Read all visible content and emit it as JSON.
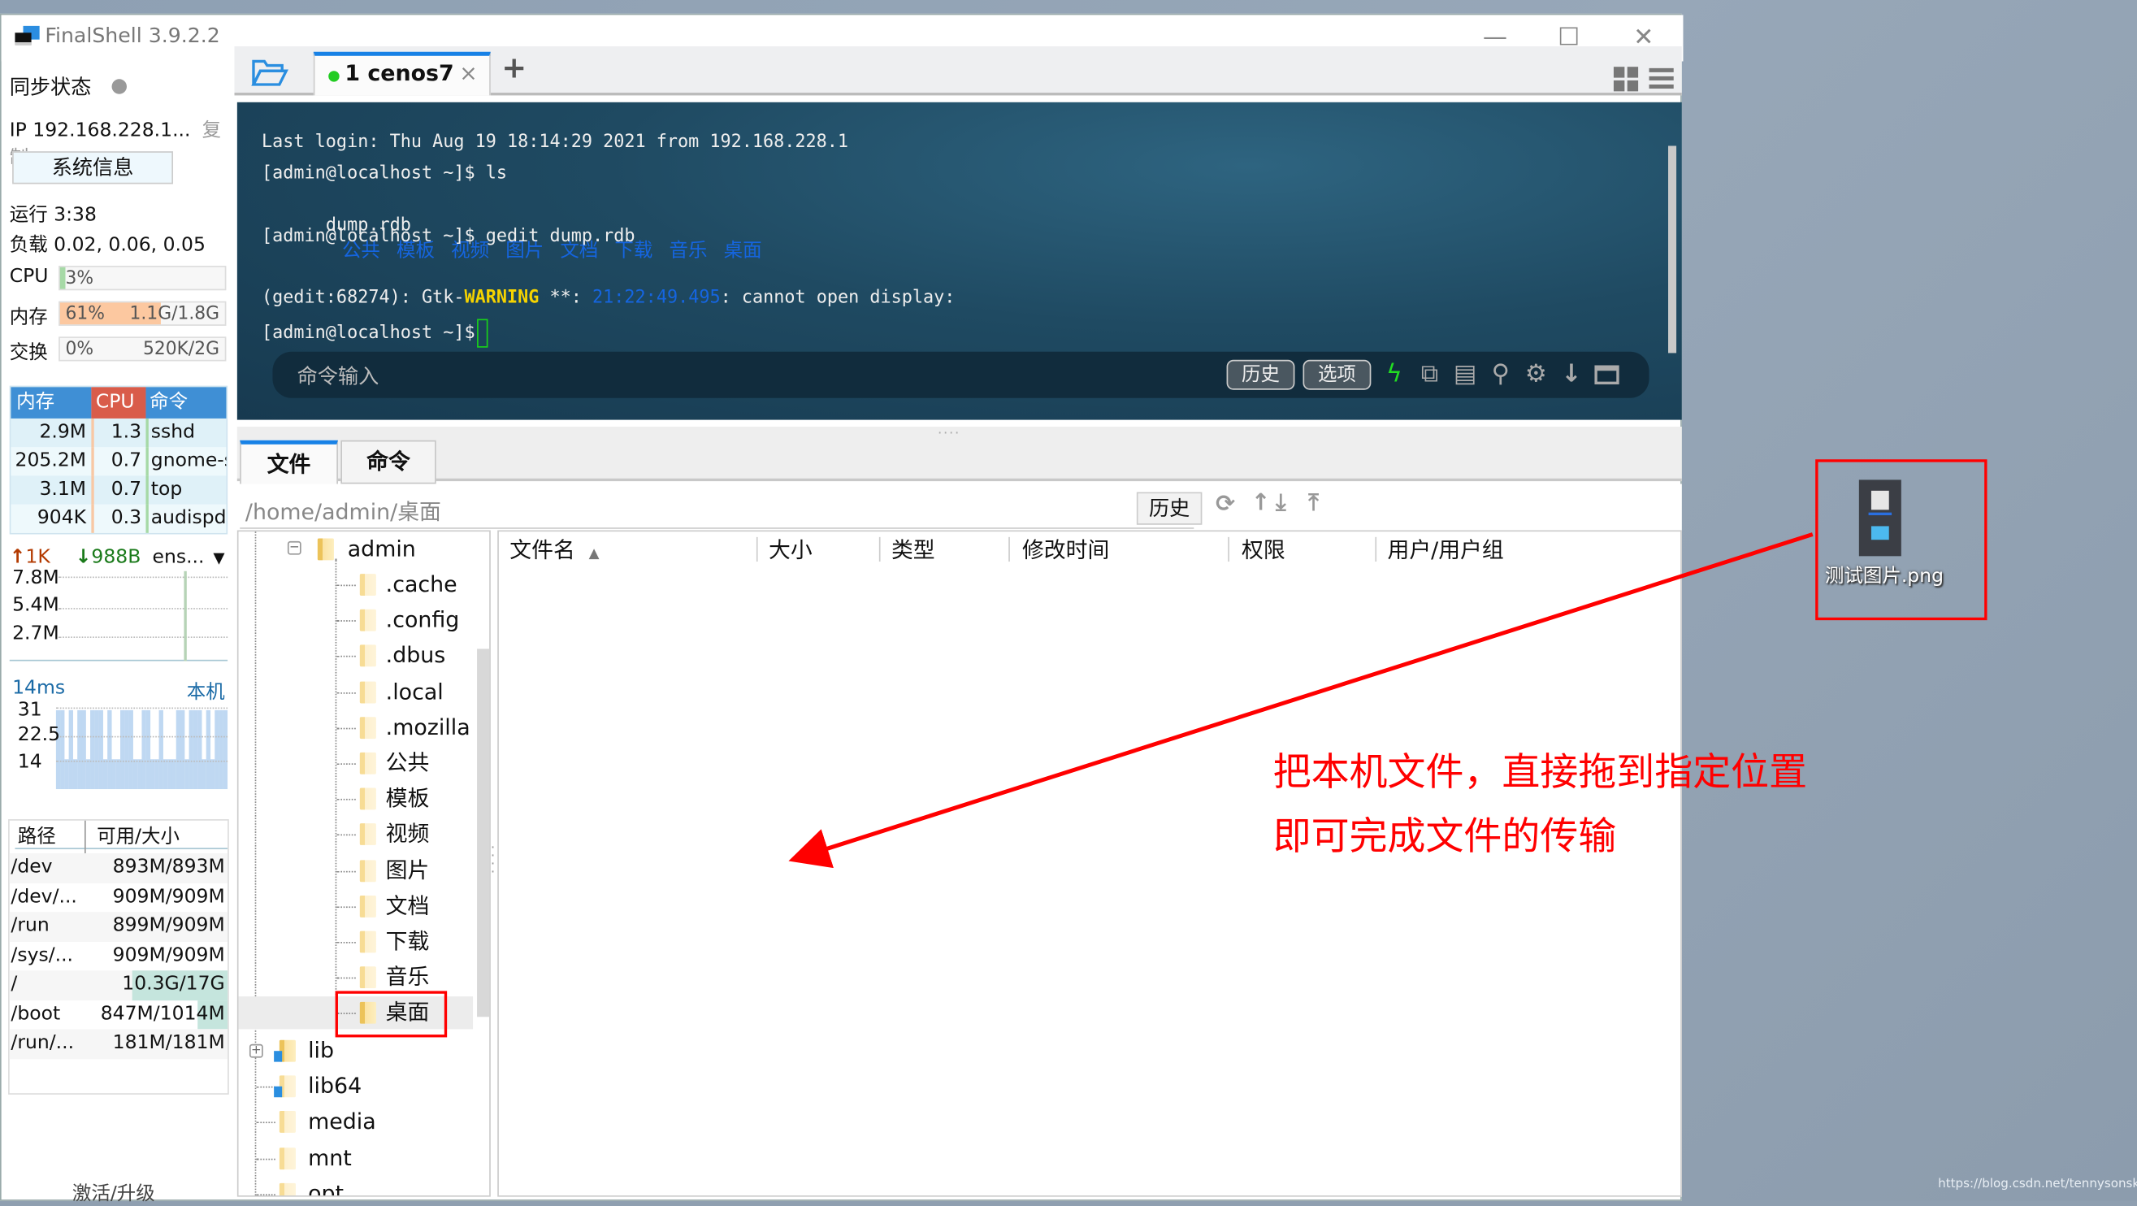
{
  "window": {
    "title": "FinalShell 3.9.2.2",
    "controls": {
      "minimize": "—",
      "maximize": "☐",
      "close": "✕"
    }
  },
  "sidebar": {
    "sync_label": "同步状态",
    "ip_label": "IP 192.168.228.1...",
    "copy_label": "复制",
    "sysinfo_button": "系统信息",
    "uptime": "运行 3:38",
    "load": "负载 0.02, 0.06, 0.05",
    "cpu": {
      "label": "CPU",
      "percent_text": "3%",
      "percent": 3
    },
    "memory": {
      "label": "内存",
      "percent_text": "61%",
      "usage": "1.1G/1.8G",
      "percent": 61
    },
    "swap": {
      "label": "交换",
      "percent_text": "0%",
      "usage": "520K/2G",
      "percent": 0
    },
    "process_table": {
      "headers": [
        "内存",
        "CPU",
        "命令"
      ],
      "rows": [
        {
          "mem": "2.9M",
          "cpu": "1.3",
          "cmd": "sshd"
        },
        {
          "mem": "205.2M",
          "cpu": "0.7",
          "cmd": "gnome-s"
        },
        {
          "mem": "3.1M",
          "cpu": "0.7",
          "cmd": "top"
        },
        {
          "mem": "904K",
          "cpu": "0.3",
          "cmd": "audispd"
        }
      ]
    },
    "network": {
      "up": "1K",
      "down": "988B",
      "interface": "ens...",
      "y_ticks": [
        "7.8M",
        "5.4M",
        "2.7M"
      ]
    },
    "latency": {
      "value": "14ms",
      "target": "本机",
      "y_ticks": [
        "31",
        "22.5",
        "14"
      ]
    },
    "disk_table": {
      "headers": [
        "路径",
        "可用/大小"
      ],
      "rows": [
        {
          "path": "/dev",
          "size": "893M/893M"
        },
        {
          "path": "/dev/...",
          "size": "909M/909M"
        },
        {
          "path": "/run",
          "size": "899M/909M"
        },
        {
          "path": "/sys/...",
          "size": "909M/909M"
        },
        {
          "path": "/",
          "size": "10.3G/17G"
        },
        {
          "path": "/boot",
          "size": "847M/1014M"
        },
        {
          "path": "/run/...",
          "size": "181M/181M"
        }
      ]
    },
    "activate_link": "激活/升级"
  },
  "session_tabs": {
    "active_tab": {
      "label": "1 cenos7",
      "close": "×",
      "status_color": "#22cc22"
    },
    "add_button": "+"
  },
  "terminal": {
    "lines": {
      "l1": "Last login: Thu Aug 19 18:14:29 2021 from 192.168.228.1",
      "l2": "[admin@localhost ~]$ ls",
      "l3_file": "dump.rdb",
      "l3_dirs": [
        "公共",
        "模板",
        "视频",
        "图片",
        "文档",
        "下载",
        "音乐",
        "桌面"
      ],
      "l4": "[admin@localhost ~]$ gedit dump.rdb",
      "l6_a": "(gedit:68274): Gtk-",
      "l6_warn": "WARNING",
      "l6_b": " **: ",
      "l6_time": "21:22:49.495",
      "l6_c": ": cannot open display:",
      "l7": "[admin@localhost ~]$ "
    },
    "command_bar": {
      "placeholder": "命令输入",
      "history_button": "历史",
      "options_button": "选项"
    }
  },
  "file_panel": {
    "tabs": [
      "文件",
      "命令"
    ],
    "path": "/home/admin/桌面",
    "history_button": "历史",
    "tree": {
      "root": "admin",
      "children": [
        ".cache",
        ".config",
        ".dbus",
        ".local",
        ".mozilla",
        "公共",
        "模板",
        "视频",
        "图片",
        "文档",
        "下载",
        "音乐",
        "桌面"
      ],
      "selected": "桌面",
      "siblings": [
        "lib",
        "lib64",
        "media",
        "mnt",
        "opt"
      ]
    },
    "columns": [
      "文件名",
      "大小",
      "类型",
      "修改时间",
      "权限",
      "用户/用户组"
    ]
  },
  "desktop": {
    "file_name": "测试图片.png",
    "annotation_line1": "把本机文件，直接拖到指定位置",
    "annotation_line2": "即可完成文件的传输",
    "watermark": "https://blog.csdn.net/tennysonsky",
    "annotation_color": "#ff0000"
  }
}
